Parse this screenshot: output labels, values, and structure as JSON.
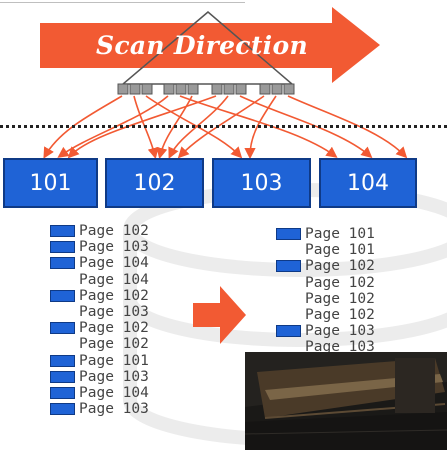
{
  "header": {
    "scan_label": "Scan Direction",
    "accent_color": "#f25a33",
    "page_color": "#1f63d6"
  },
  "pages": [
    {
      "label": "101"
    },
    {
      "label": "102"
    },
    {
      "label": "103"
    },
    {
      "label": "104"
    }
  ],
  "left_list": [
    {
      "text": "Page 102",
      "marked": true
    },
    {
      "text": "Page 103",
      "marked": true
    },
    {
      "text": "Page 104",
      "marked": true
    },
    {
      "text": "Page 104",
      "marked": false
    },
    {
      "text": "Page 102",
      "marked": true
    },
    {
      "text": "Page 103",
      "marked": false
    },
    {
      "text": "Page 102",
      "marked": true
    },
    {
      "text": "Page 102",
      "marked": false
    },
    {
      "text": "Page 101",
      "marked": true
    },
    {
      "text": "Page 103",
      "marked": true
    },
    {
      "text": "Page 104",
      "marked": true
    },
    {
      "text": "Page 103",
      "marked": true
    }
  ],
  "right_list": [
    {
      "text": "Page 101",
      "marked": true
    },
    {
      "text": "Page 101",
      "marked": false
    },
    {
      "text": "Page 102",
      "marked": true
    },
    {
      "text": "Page 102",
      "marked": false
    },
    {
      "text": "Page 102",
      "marked": false
    },
    {
      "text": "Page 102",
      "marked": false
    },
    {
      "text": "Page 103",
      "marked": true
    },
    {
      "text": "Page 103",
      "marked": false
    }
  ]
}
